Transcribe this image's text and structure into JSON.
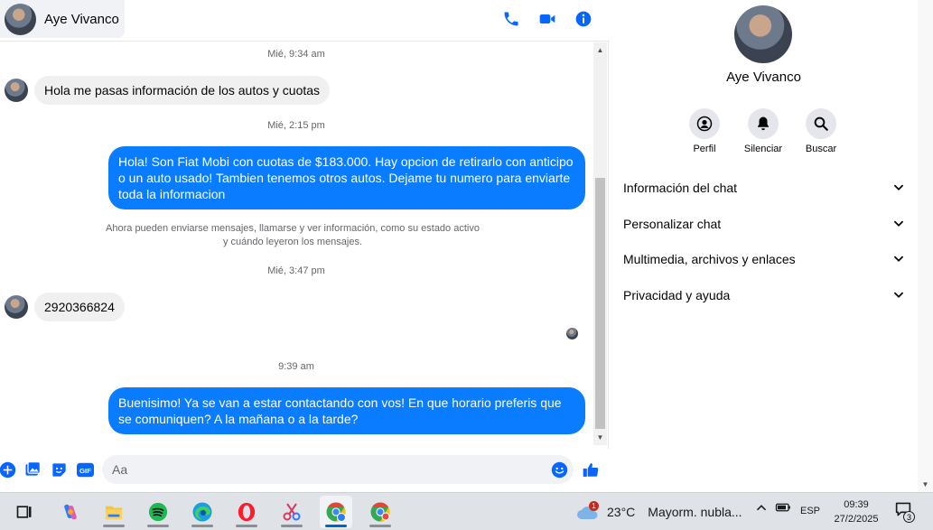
{
  "colors": {
    "accent": "#0a7cff",
    "header_icon": "#0866ff",
    "incoming_bubble": "#f0f0f0",
    "outgoing_text": "#ffffff",
    "muted_text": "#65676b"
  },
  "header": {
    "contact_name": "Aye Vivanco",
    "actions": [
      {
        "name": "call",
        "icon": "phone-icon"
      },
      {
        "name": "video",
        "icon": "video-camera-icon"
      },
      {
        "name": "info",
        "icon": "info-icon"
      }
    ]
  },
  "messages": {
    "timestamps": [
      "Mié, 9:34 am",
      "Mié, 2:15 pm",
      "Mié, 3:47 pm",
      "9:39 am"
    ],
    "incoming": [
      "Hola me pasas información de los autos y cuotas",
      "2920366824"
    ],
    "outgoing": [
      "Hola! Son Fiat Mobi con cuotas de $183.000. Hay opcion de retirarlo con anticipo o un auto usado! Tambien tenemos otros autos. Dejame tu numero para enviarte toda la informacion",
      "Buenisimo! Ya se van a estar contactando con vos! En que horario preferis que se comuniquen? A la mañana o a la tarde?"
    ],
    "notice_line1": "Ahora pueden enviarse mensajes, llamarse y ver información, como su estado activo",
    "notice_line2": "y cuándo leyeron los mensajes."
  },
  "composer": {
    "placeholder": "Aa",
    "icons": [
      "plus-icon",
      "image-icon",
      "sticker-icon",
      "gif-icon",
      "emoji-icon",
      "like-icon"
    ],
    "gif_label": "GIF"
  },
  "details": {
    "name": "Aye Vivanco",
    "actions": [
      {
        "label": "Perfil",
        "icon": "profile-icon"
      },
      {
        "label": "Silenciar",
        "icon": "bell-icon"
      },
      {
        "label": "Buscar",
        "icon": "search-icon"
      }
    ],
    "sections": [
      "Información del chat",
      "Personalizar chat",
      "Multimedia, archivos y enlaces",
      "Privacidad y ayuda"
    ]
  },
  "taskbar": {
    "apps": [
      "task-view-icon",
      "copilot-icon",
      "file-explorer-icon",
      "spotify-icon",
      "edge-icon",
      "opera-icon",
      "snip-icon",
      "chrome-profile-icon",
      "chrome-icon"
    ],
    "weather_temp": "23°C",
    "weather_desc": "Mayorm. nubla...",
    "weather_badge": "1",
    "language": "ESP",
    "time": "09:39",
    "date": "27/2/2025",
    "notification_count": "3"
  }
}
